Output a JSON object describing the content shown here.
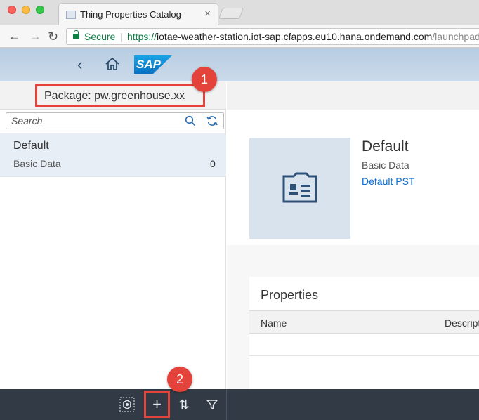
{
  "browser": {
    "tab_title": "Thing Properties Catalog",
    "tab_close": "×",
    "nav_back": "←",
    "nav_forward": "→",
    "nav_reload": "↻",
    "secure_label": "Secure",
    "url_scheme": "https://",
    "url_host": "iotae-weather-station.iot-sap.cfapps.eu10.hana.ondemand.com",
    "url_path": "/launchpad"
  },
  "shell": {
    "back_glyph": "‹",
    "logo_text": "SAP"
  },
  "master": {
    "package_label": "Package: pw.greenhouse.xx",
    "search_placeholder": "Search",
    "items": [
      {
        "title": "Default",
        "subtitle": "Basic Data",
        "count": "0"
      }
    ]
  },
  "detail": {
    "title": "Default",
    "subtitle": "Basic Data",
    "link": "Default PST",
    "properties_title": "Properties",
    "columns": [
      "Name",
      "Description"
    ]
  },
  "footer": {
    "add_glyph": "+",
    "sort_glyph": "⇅"
  },
  "annotations": {
    "marker1": "1",
    "marker2": "2",
    "color": "#e3433b"
  },
  "colors": {
    "shell_bar": "#c2d4e7",
    "footer": "#323b45",
    "link": "#0a6ed1",
    "selected_item": "#e8eef5"
  }
}
